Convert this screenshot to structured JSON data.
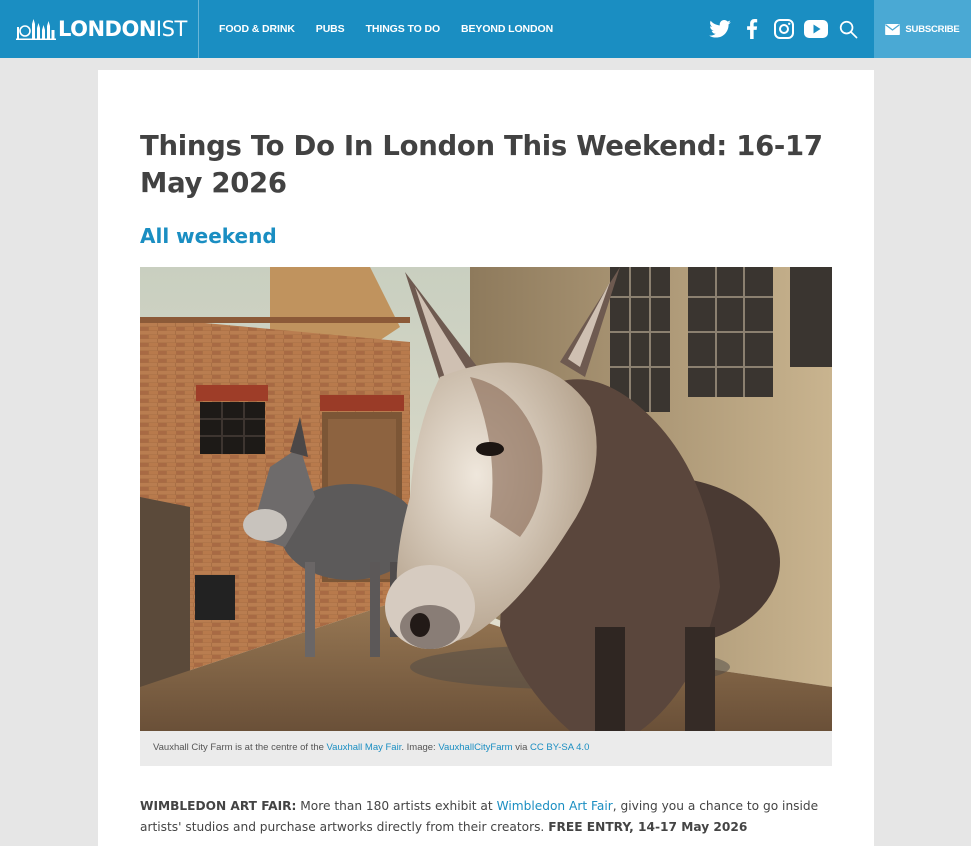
{
  "header": {
    "logo_text_bold": "LONDON",
    "logo_text_light": "IST",
    "nav": [
      "FOOD & DRINK",
      "PUBS",
      "THINGS TO DO",
      "BEYOND LONDON"
    ],
    "social_icons": [
      "twitter-icon",
      "facebook-icon",
      "instagram-icon",
      "youtube-icon",
      "search-icon"
    ],
    "subscribe_label": "SUBSCRIBE",
    "brand_color": "#1a8ec2"
  },
  "article": {
    "title": "Things To Do In London This Weekend: 16-17 May 2026",
    "section": "All weekend",
    "caption": {
      "prefix": "Vauxhall City Farm is at the centre of the ",
      "link1": "Vauxhall May Fair",
      "mid": ". Image: ",
      "link2": "VauxhallCityFarm",
      "via": " via ",
      "link3": "CC BY-SA 4.0"
    },
    "item": {
      "label": "WIMBLEDON ART FAIR:",
      "text_before": " More than 180 artists exhibit at ",
      "link": "Wimbledon Art Fair",
      "text_after": ", giving you a chance to go inside artists' studios and purchase artworks directly from their creators. ",
      "footer": "FREE ENTRY, 14-17 May 2026"
    }
  }
}
